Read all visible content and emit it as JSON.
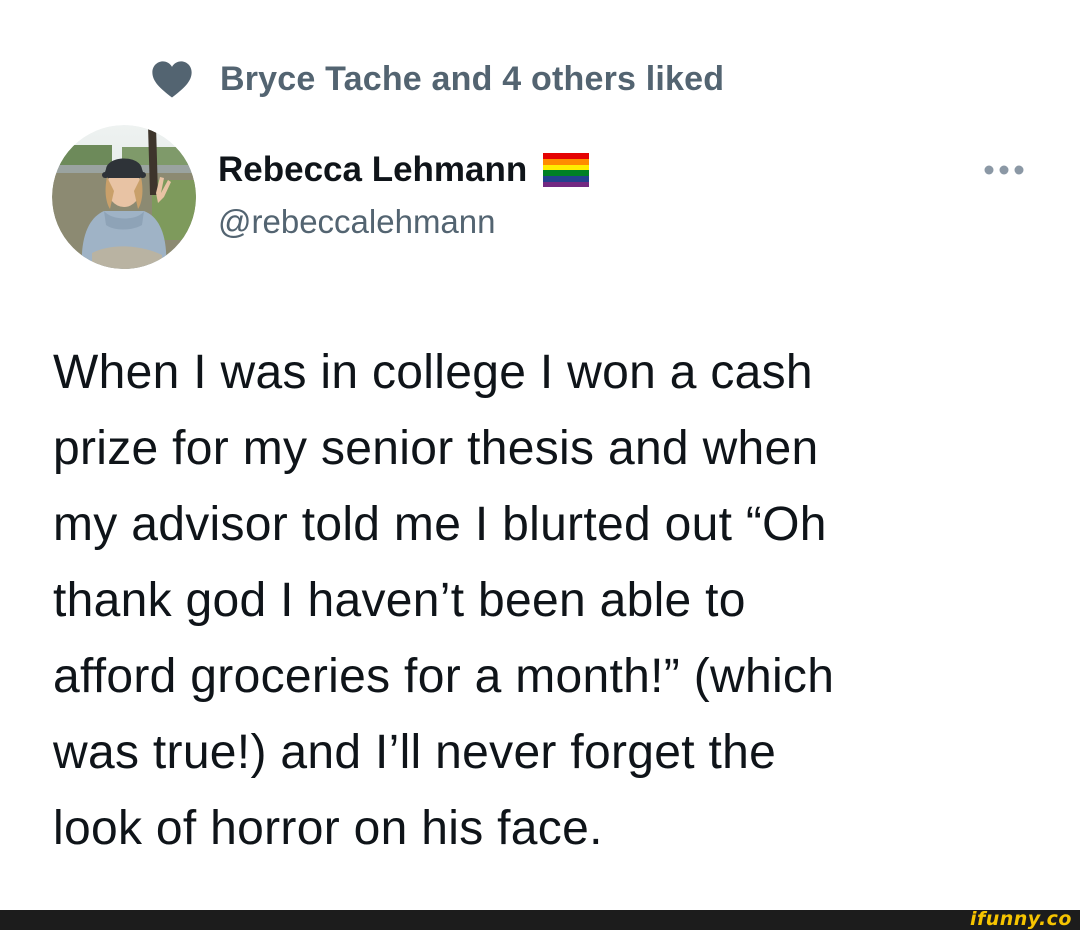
{
  "social_context": {
    "icon": "heart-icon",
    "text": "Bryce Tache and 4 others liked"
  },
  "author": {
    "name": "Rebecca Lehmann",
    "name_badge_icon": "rainbow-flag-icon",
    "handle": "@rebeccalehmann",
    "avatar": "avatar-photo"
  },
  "more_menu": {
    "icon": "more-horizontal-icon"
  },
  "tweet": {
    "lines": [
      "When I was in college I won a cash",
      "prize for my senior thesis and when",
      "my advisor told me I blurted out “Oh",
      "thank god I haven’t been able to",
      "afford groceries for a month!” (which",
      "was true!) and I’ll never forget the",
      "look of horror on his face."
    ]
  },
  "watermark": {
    "text": "ifunny.co"
  },
  "colors": {
    "primary_text": "#0f1419",
    "secondary_text": "#536471",
    "heart": "#536471",
    "footer_bar": "#1c1c1c",
    "watermark": "#f6c400"
  }
}
